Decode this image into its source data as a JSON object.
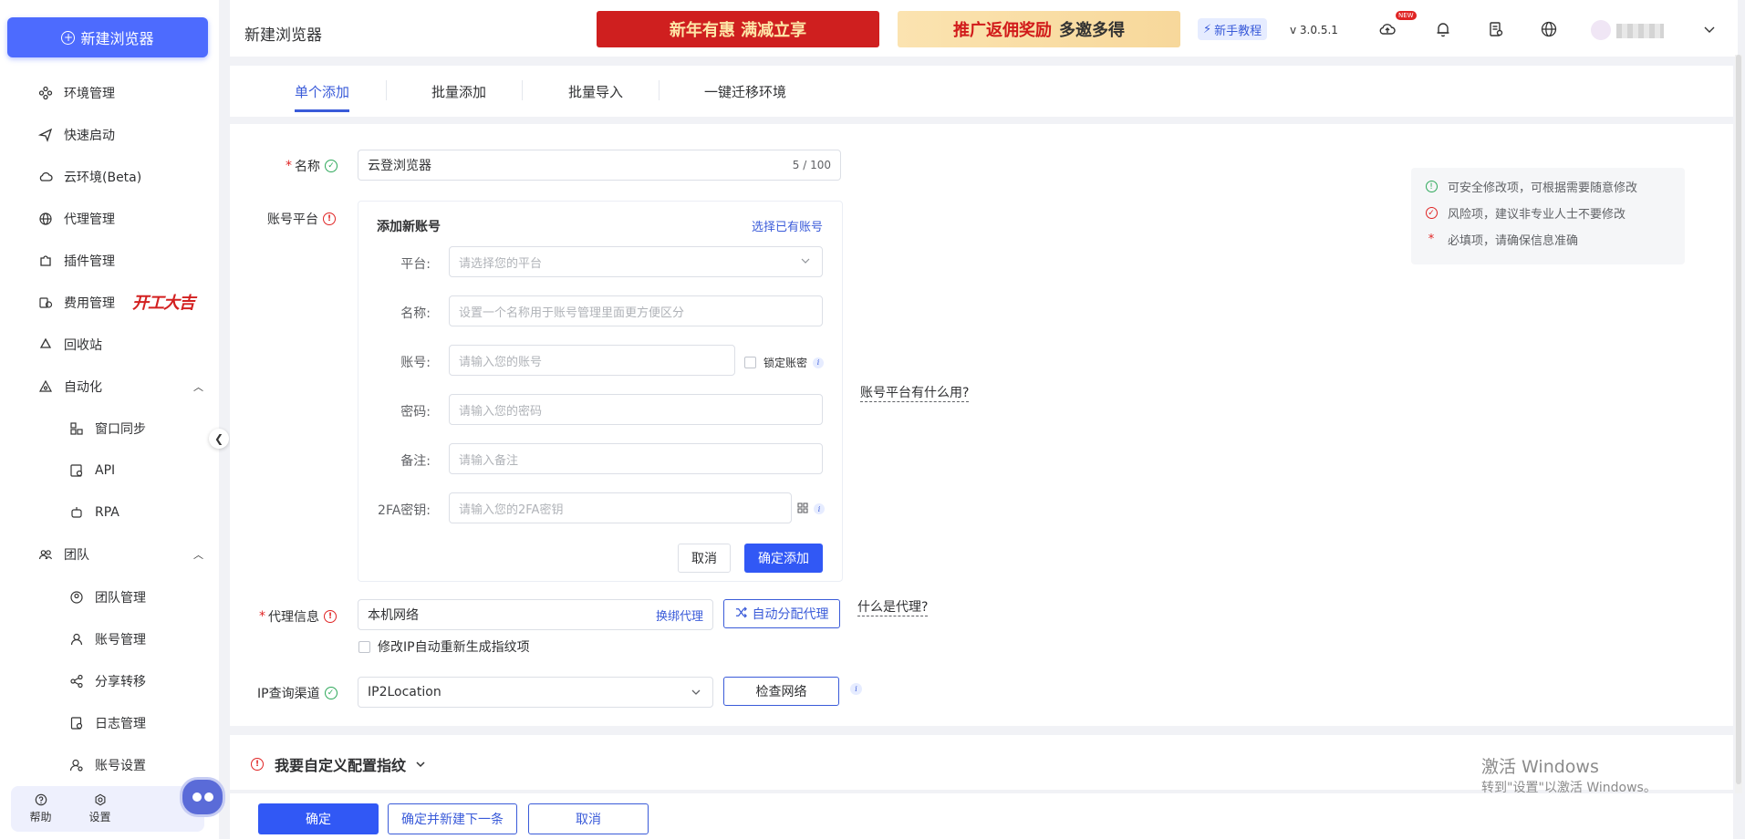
{
  "sidebar": {
    "new_browser_label": "新建浏览器",
    "items": [
      {
        "label": "环境管理"
      },
      {
        "label": "快速启动"
      },
      {
        "label": "云环境(Beta)"
      },
      {
        "label": "代理管理"
      },
      {
        "label": "插件管理"
      },
      {
        "label": "费用管理"
      },
      {
        "label": "回收站"
      },
      {
        "label": "自动化"
      },
      {
        "label": "窗口同步"
      },
      {
        "label": "API"
      },
      {
        "label": "RPA"
      },
      {
        "label": "团队"
      },
      {
        "label": "团队管理"
      },
      {
        "label": "账号管理"
      },
      {
        "label": "分享转移"
      },
      {
        "label": "日志管理"
      },
      {
        "label": "账号设置"
      }
    ],
    "promo_badge": "开工大吉",
    "help_label": "帮助",
    "settings_label": "设置"
  },
  "header": {
    "title": "新建浏览器",
    "banner1": "新年有惠 满减立享",
    "banner2_a": "推广返佣奖励",
    "banner2_b": "多邀多得",
    "tutorial": "新手教程",
    "version": "v 3.0.5.1",
    "new_badge": "NEW"
  },
  "tabs": [
    "单个添加",
    "批量添加",
    "批量导入",
    "一键迁移环境"
  ],
  "form": {
    "name_label": "名称",
    "name_value": "云登浏览器",
    "name_counter": "5 / 100",
    "account_platform_label": "账号平台",
    "account_box": {
      "title": "添加新账号",
      "select_existing": "选择已有账号",
      "platform_label": "平台:",
      "platform_placeholder": "请选择您的平台",
      "name_label": "名称:",
      "name_placeholder": "设置一个名称用于账号管理里面更方便区分",
      "account_label": "账号:",
      "account_placeholder": "请输入您的账号",
      "lock_label": "锁定账密",
      "password_label": "密码:",
      "password_placeholder": "请输入您的密码",
      "remark_label": "备注:",
      "remark_placeholder": "请输入备注",
      "twofa_label": "2FA密钥:",
      "twofa_placeholder": "请输入您的2FA密钥",
      "cancel": "取消",
      "confirm_add": "确定添加"
    },
    "account_platform_help": "账号平台有什么用?",
    "proxy_label": "代理信息",
    "proxy_value": "本机网络",
    "proxy_rebind": "换绑代理",
    "auto_proxy": "自动分配代理",
    "proxy_help": "什么是代理?",
    "regen_checkbox_label": "修改IP自动重新生成指纹项",
    "ip_channel_label": "IP查询渠道",
    "ip_channel_value": "IP2Location",
    "check_network": "检查网络"
  },
  "legend": {
    "safe": "可安全修改项，可根据需要随意修改",
    "risk": "风险项，建议非专业人士不要修改",
    "required": "必填项，请确保信息准确",
    "required_mark": "*"
  },
  "custom_fingerprint": "我要自定义配置指纹",
  "footer": {
    "confirm": "确定",
    "confirm_next": "确定并新建下一条",
    "cancel": "取消"
  },
  "watermark": {
    "line1": "激活 Windows",
    "line2": "转到\"设置\"以激活 Windows。"
  },
  "colors": {
    "primary": "#3158f5",
    "new_button": "#4d6bfe",
    "safe_green": "#2fa95b",
    "risk_red": "#e02424"
  }
}
